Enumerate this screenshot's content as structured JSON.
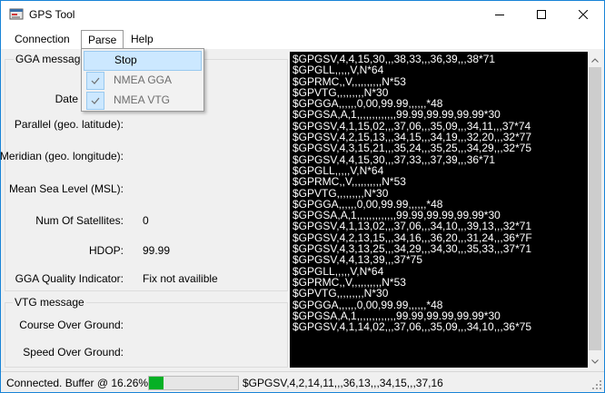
{
  "window": {
    "title": "GPS Tool"
  },
  "menu": {
    "connection": "Connection",
    "parse": "Parse",
    "help": "Help"
  },
  "parse_menu": {
    "items": [
      {
        "label": "Stop",
        "checked": false,
        "enabled": true,
        "highlighted": true
      },
      {
        "label": "NMEA GGA",
        "checked": true,
        "enabled": false
      },
      {
        "label": "NMEA VTG",
        "checked": true,
        "enabled": false
      }
    ]
  },
  "gga": {
    "legend": "GGA message,",
    "date_label": "Date",
    "latitude_label": "Parallel (geo. latitude):",
    "longitude_label": "Meridian (geo. longitude):",
    "msl_label": "Mean Sea Level (MSL):",
    "satellites_label": "Num Of Satellites:",
    "satellites_value": "0",
    "hdop_label": "HDOP:",
    "hdop_value": "99.99",
    "quality_label": "GGA Quality Indicator:",
    "quality_value": "Fix not availible"
  },
  "vtg": {
    "legend": "VTG message",
    "course_label": "Course Over Ground:",
    "speed_label": "Speed Over Ground:"
  },
  "console": {
    "lines": [
      "$GPGSV,4,4,15,30,,,38,33,,,36,39,,,38*71",
      "$GPGLL,,,,,V,N*64",
      "$GPRMC,,V,,,,,,,,,,N*53",
      "$GPVTG,,,,,,,,,N*30",
      "$GPGGA,,,,,,0,00,99.99,,,,,,*48",
      "$GPGSA,A,1,,,,,,,,,,,,,99.99,99.99,99.99*30",
      "$GPGSV,4,1,15,02,,,37,06,,,35,09,,,34,11,,,37*74",
      "$GPGSV,4,2,15,13,,,34,15,,,34,19,,,32,20,,,32*77",
      "$GPGSV,4,3,15,21,,,35,24,,,35,25,,,34,29,,,32*75",
      "$GPGSV,4,4,15,30,,,37,33,,,37,39,,,36*71",
      "$GPGLL,,,,,V,N*64",
      "$GPRMC,,V,,,,,,,,,,N*53",
      "$GPVTG,,,,,,,,,N*30",
      "$GPGGA,,,,,,0,00,99.99,,,,,,*48",
      "$GPGSA,A,1,,,,,,,,,,,,,99.99,99.99,99.99*30",
      "$GPGSV,4,1,13,02,,,37,06,,,34,10,,,39,13,,,32*71",
      "$GPGSV,4,2,13,15,,,34,16,,,36,20,,,31,24,,,36*7F",
      "$GPGSV,4,3,13,25,,,34,29,,,34,30,,,35,33,,,37*71",
      "$GPGSV,4,4,13,39,,,37*75",
      "$GPGLL,,,,,V,N*64",
      "$GPRMC,,V,,,,,,,,,,N*53",
      "$GPVTG,,,,,,,,,N*30",
      "$GPGGA,,,,,,0,00,99.99,,,,,,*48",
      "$GPGSA,A,1,,,,,,,,,,,,,99.99,99.99,99.99*30",
      "$GPGSV,4,1,14,02,,,37,06,,,35,09,,,34,10,,,36*75"
    ]
  },
  "status": {
    "text": "Connected. Buffer @ 16.26%.",
    "buffer_fraction": 0.1626,
    "last_sentence": "$GPGSV,4,2,14,11,,,36,13,,,34,15,,,37,16"
  },
  "colors": {
    "console_bg": "#000000",
    "console_fg": "#ffffff",
    "progress_fill": "#06b025",
    "highlight": "#cce8ff",
    "window_border": "#1883d7"
  },
  "icons": {
    "app": "gps-tool-app-icon",
    "minimize": "minimize-icon",
    "maximize": "maximize-icon",
    "close": "close-icon",
    "check": "checkmark-icon"
  }
}
